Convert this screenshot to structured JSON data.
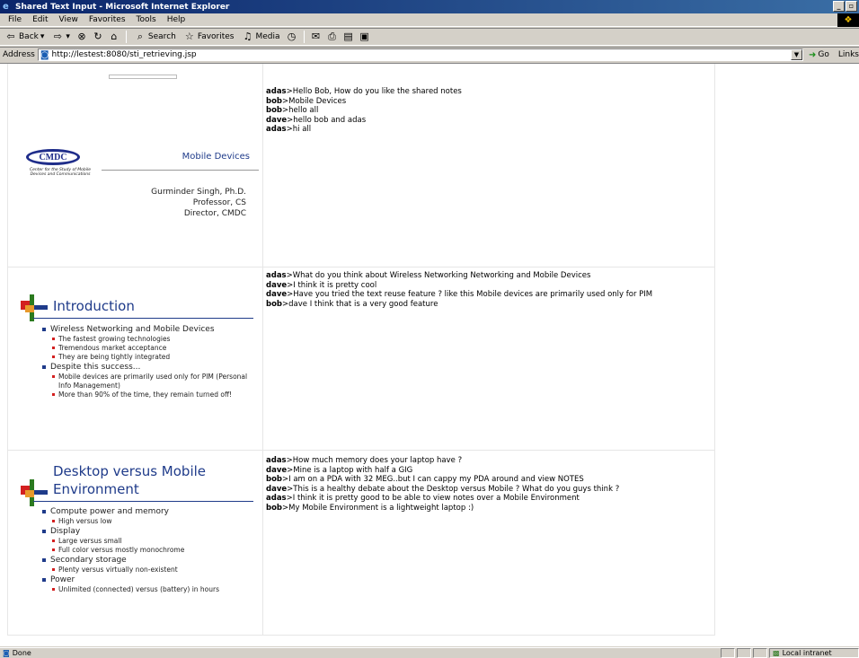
{
  "window": {
    "title": "Shared Text Input - Microsoft Internet Explorer",
    "buttons": [
      "_",
      "▫"
    ]
  },
  "menu": [
    "File",
    "Edit",
    "View",
    "Favorites",
    "Tools",
    "Help"
  ],
  "toolbar": {
    "back": "Back",
    "search": "Search",
    "favorites": "Favorites",
    "media": "Media"
  },
  "address": {
    "label": "Address",
    "url": "http://lestest:8080/sti_retrieving.jsp",
    "go": "Go",
    "links": "Links"
  },
  "slides": {
    "s1": {
      "logo": "CMDC",
      "logo_sub": "Center for the Study of Mobile Devices and Communications",
      "title": "Mobile Devices",
      "presenter": [
        "Gurminder Singh, Ph.D.",
        "Professor, CS",
        "Director, CMDC"
      ]
    },
    "s2": {
      "title": "Introduction",
      "bullets": [
        {
          "text": "Wireless Networking and Mobile Devices",
          "sub": [
            "The fastest growing technologies",
            "Tremendous market acceptance",
            "They are being tightly integrated"
          ]
        },
        {
          "text": "Despite this success...",
          "sub": [
            "Mobile devices are primarily used only for PIM (Personal Info Management)",
            "More than 90% of the time, they remain turned off!"
          ]
        }
      ]
    },
    "s3": {
      "title_line1": "Desktop versus Mobile",
      "title_line2": "Environment",
      "bullets": [
        {
          "text": "Compute power and memory",
          "sub": [
            "High versus low"
          ]
        },
        {
          "text": "Display",
          "sub": [
            "Large versus small",
            "Full color versus mostly monochrome"
          ]
        },
        {
          "text": "Secondary storage",
          "sub": [
            "Plenty versus virtually non-existent"
          ]
        },
        {
          "text": "Power",
          "sub": [
            "Unlimited (connected) versus (battery) in hours"
          ]
        }
      ]
    }
  },
  "chats": {
    "c1": [
      {
        "user": "adas",
        "msg": ">Hello Bob, How do you like the shared notes"
      },
      {
        "user": "bob",
        "msg": ">Mobile Devices"
      },
      {
        "user": "bob",
        "msg": ">hello all"
      },
      {
        "user": "dave",
        "msg": ">hello bob and adas"
      },
      {
        "user": "adas",
        "msg": ">hi all"
      }
    ],
    "c2": [
      {
        "user": "adas",
        "msg": ">What do you think about Wireless Networking Networking and Mobile Devices"
      },
      {
        "user": "dave",
        "msg": ">I think it is pretty cool"
      },
      {
        "user": "dave",
        "msg": ">Have you tried the text reuse feature ? like this Mobile devices are primarily used only for PIM"
      },
      {
        "user": "bob",
        "msg": ">dave I think that is a very good feature"
      }
    ],
    "c3": [
      {
        "user": "adas",
        "msg": ">How much memory does your laptop have ?"
      },
      {
        "user": "dave",
        "msg": ">Mine is a laptop with half a GIG"
      },
      {
        "user": "bob",
        "msg": ">I am on a PDA with 32 MEG..but I can cappy my PDA around and view NOTES"
      },
      {
        "user": "dave",
        "msg": ">This is a healthy debate about the Desktop versus Mobile ? What do you guys think ?"
      },
      {
        "user": "adas",
        "msg": ">I think it is pretty good to be able to view notes over a Mobile Environment"
      },
      {
        "user": "bob",
        "msg": ">My Mobile Environment is a lightweight laptop :)"
      }
    ]
  },
  "status": {
    "text": "Done",
    "zone": "Local intranet"
  }
}
